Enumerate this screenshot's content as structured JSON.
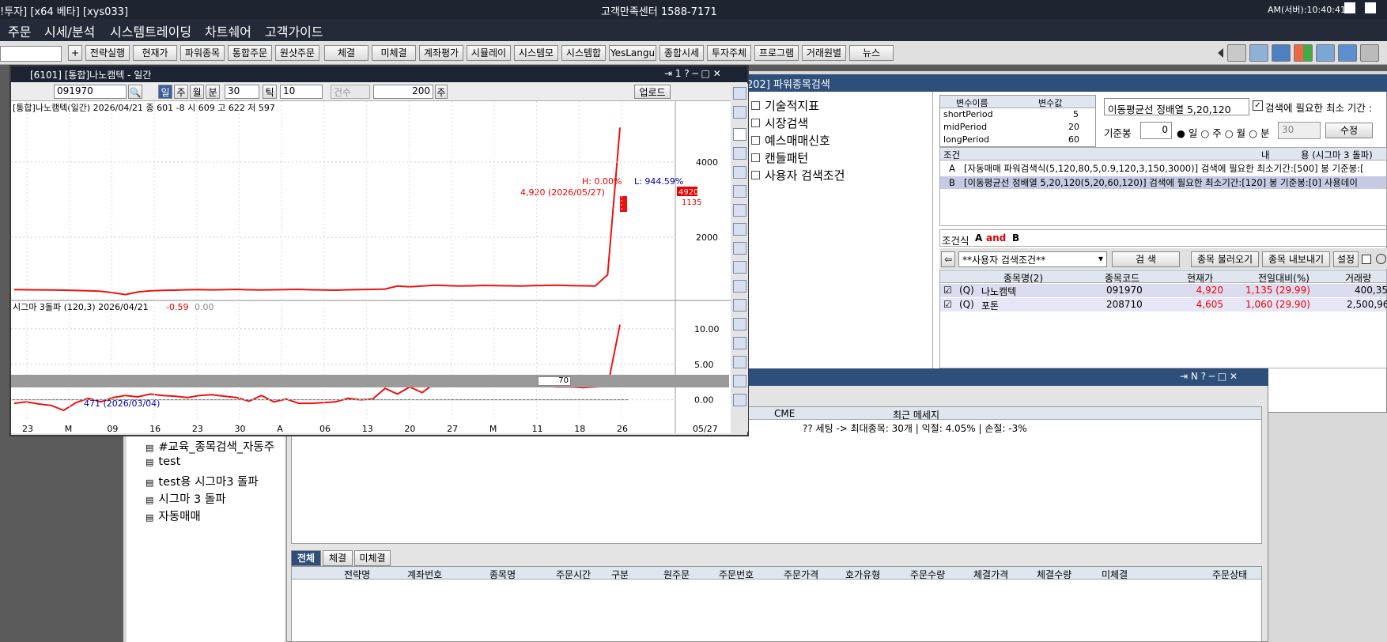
{
  "titlebar": {
    "left": "!투자] [x64 베타] [xys033]",
    "center": "고객만족센터 1588-7171",
    "right": "AM(서버):10:40:41"
  },
  "menu": [
    "주문",
    "시세/분석",
    "시스템트레이딩",
    "차트쉐어",
    "고객가이드"
  ],
  "toolbar": [
    "전략실행",
    "현재가",
    "파워종목",
    "통합주문",
    "원샷주문",
    "체결",
    "미체결",
    "계좌평가",
    "시뮬레이",
    "시스템모",
    "시스템합",
    "YesLangu",
    "종합시세",
    "투자주체",
    "프로그램",
    "거래원별",
    "뉴스"
  ],
  "power_window": {
    "title": "202] 파워종목검색",
    "tree": [
      "기술적지표",
      "시장검색",
      "예스매매신호",
      "캔들패턴",
      "사용자 검색조건"
    ],
    "var_headers": [
      "변수이름",
      "변수값"
    ],
    "vars": [
      {
        "name": "shortPeriod",
        "value": "5"
      },
      {
        "name": "midPeriod",
        "value": "20"
      },
      {
        "name": "longPeriod",
        "value": "60"
      }
    ],
    "selected_cond": "이동평균선 정배열 5,20,120",
    "min_period_label": "검색에 필요한 최소 기간 :",
    "base_label": "기준봉",
    "base_value": "0",
    "period_options": [
      "일",
      "주",
      "월",
      "분"
    ],
    "period_sel": "30",
    "edit_btn": "수정",
    "cond_headers": [
      "조건",
      "내",
      "용 (시그마 3 돌파)"
    ],
    "conds": [
      {
        "id": "A",
        "text": "[자동매매 파워검색식(5,120,80,5,0.9,120,3,150,3000)] 검색에 필요한 최소기간:[500] 봉  기준봉:["
      },
      {
        "id": "B",
        "text": "[이동평균선 정배열 5,20,120(5,20,60,120)] 검색에 필요한 최소기간:[120] 봉  기준봉:[0] 사용데이"
      }
    ],
    "formula_label": "조건식",
    "formula_a": "A",
    "formula_op": "and",
    "formula_b": "B",
    "search_select": "**사용자 검색조건**",
    "btn_search": "검      색",
    "btn_load": "종목 불러오기",
    "btn_export": "종목 내보내기",
    "btn_setting": "설정",
    "result_headers": [
      "종목명(2)",
      "종목코드",
      "현재가",
      "전일대비(%)",
      "거래량"
    ],
    "results": [
      {
        "tag": "(Q)",
        "name": "나노캠텍",
        "code": "091970",
        "price": "4,920",
        "change": "1,135 (29.99)",
        "volume": "400,35"
      },
      {
        "tag": "(Q)",
        "name": "포톤",
        "code": "208710",
        "price": "4,605",
        "change": "1,060 (29.90)",
        "volume": "2,500,96"
      }
    ]
  },
  "left_list": [
    "#교육_종목검색_자동주",
    "test",
    "test용 시그마3 돌파",
    "시그마 3 돌파",
    "자동매매"
  ],
  "messages": {
    "col_cme": "CME",
    "col_msg": "최근 메세지",
    "msg": "?? 세팅 -> 최대종목: 30개 | 익절: 4.05% | 손절: -3%"
  },
  "order_tabs": [
    "전체",
    "체결",
    "미체결"
  ],
  "order_headers": [
    "전략명",
    "계좌번호",
    "종목명",
    "주문시간",
    "구분",
    "원주문",
    "주문번호",
    "주문가격",
    "호가유형",
    "주문수량",
    "체결가격",
    "체결수량",
    "미체결",
    "주문상태"
  ],
  "chart_window": {
    "title": "[6101] [통합]나노캠텍 - 일간",
    "code": "091970",
    "period_buttons": [
      "일",
      "주",
      "월",
      "분"
    ],
    "period_count": "30",
    "tick_label": "틱",
    "tick_value": "10",
    "count_label": "건수",
    "count_value": "200",
    "count_unit": "주",
    "upload": "업로드",
    "zoom_value": "70",
    "end_date": "05/27",
    "price_header": "[통합]나노캠텍(일간) 2026/04/21  종 601 -8  시 609 고 622 저 597",
    "high_label": "H: 0.00%",
    "low_label": "L: 944.59%",
    "last_box": "4920",
    "last_change": "1135",
    "max_label": "4,920 (2026/05/27)",
    "min_label": "471 (2026/03/04)",
    "sigma_header": "시그마 3돌파  (120,3) 2026/04/21",
    "sigma_val1": "-0.59",
    "sigma_val2": "0.00"
  },
  "chart_data": [
    {
      "type": "line",
      "title": "[통합]나노캠텍(일간)",
      "xlabel": "",
      "ylabel": "",
      "ylim": [
        400,
        5200
      ],
      "x_ticks": [
        "23",
        "M",
        "09",
        "16",
        "23",
        "30",
        "A",
        "06",
        "13",
        "20",
        "27",
        "M",
        "11",
        "18",
        "26"
      ],
      "y_ticks": [
        "2000",
        "4000"
      ],
      "series": [
        {
          "values": [
            605,
            600,
            598,
            595,
            590,
            582,
            575,
            560,
            520,
            471,
            540,
            570,
            585,
            590,
            600,
            605,
            598,
            602,
            610,
            600,
            595,
            600,
            605,
            610,
            600,
            595,
            590,
            600,
            605,
            610,
            620,
            700,
            680,
            700,
            720,
            710,
            700,
            705,
            715,
            710,
            705,
            700,
            710,
            715,
            720,
            710,
            705,
            700,
            1000,
            4920
          ]
        }
      ]
    },
    {
      "type": "line",
      "title": "시그마 3돌파 (120,3)",
      "ylim": [
        -2.5,
        12
      ],
      "y_ticks": [
        "0.00",
        "5.00",
        "10.00"
      ],
      "series": [
        {
          "values": [
            -0.5,
            -0.3,
            -0.6,
            -0.8,
            -1.5,
            -0.4,
            0.2,
            -0.3,
            0.3,
            0.6,
            0.4,
            0.8,
            0.6,
            0.5,
            0.3,
            0.6,
            0.7,
            0.5,
            0.3,
            -0.2,
            0.6,
            -0.3,
            0.1,
            -0.5,
            -0.5,
            -0.4,
            -0.3,
            0.2,
            0.0,
            0.1,
            1.6,
            0.8,
            1.8,
            1.0,
            2.3,
            2.4,
            2.3,
            2.2,
            2.2,
            2.1,
            2.1,
            2.0,
            2.0,
            1.9,
            1.8,
            1.8,
            1.7,
            1.8,
            1.9,
            10.6
          ]
        }
      ]
    }
  ]
}
